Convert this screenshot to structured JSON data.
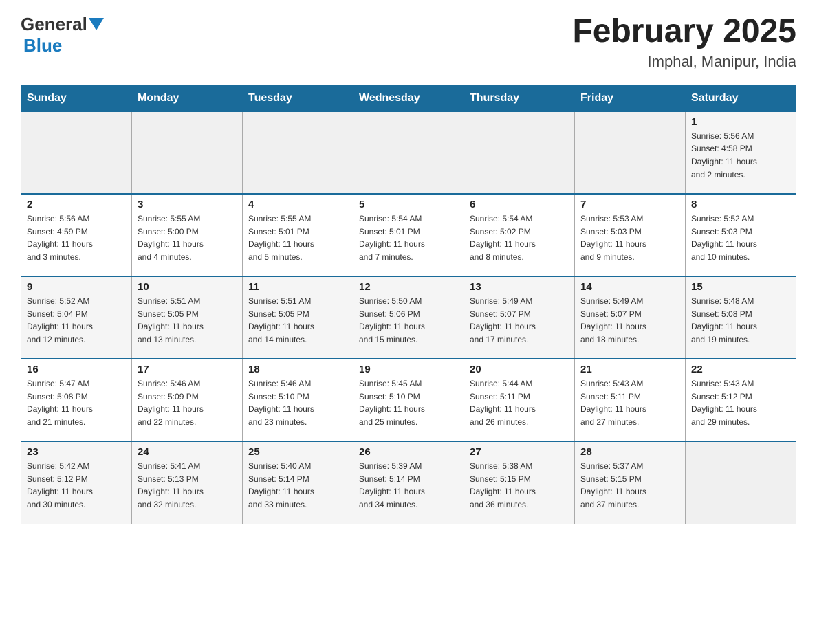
{
  "header": {
    "logo_general": "General",
    "logo_blue": "Blue",
    "month_title": "February 2025",
    "location": "Imphal, Manipur, India"
  },
  "days_of_week": [
    "Sunday",
    "Monday",
    "Tuesday",
    "Wednesday",
    "Thursday",
    "Friday",
    "Saturday"
  ],
  "weeks": [
    {
      "days": [
        {
          "num": "",
          "info": ""
        },
        {
          "num": "",
          "info": ""
        },
        {
          "num": "",
          "info": ""
        },
        {
          "num": "",
          "info": ""
        },
        {
          "num": "",
          "info": ""
        },
        {
          "num": "",
          "info": ""
        },
        {
          "num": "1",
          "info": "Sunrise: 5:56 AM\nSunset: 4:58 PM\nDaylight: 11 hours\nand 2 minutes."
        }
      ]
    },
    {
      "days": [
        {
          "num": "2",
          "info": "Sunrise: 5:56 AM\nSunset: 4:59 PM\nDaylight: 11 hours\nand 3 minutes."
        },
        {
          "num": "3",
          "info": "Sunrise: 5:55 AM\nSunset: 5:00 PM\nDaylight: 11 hours\nand 4 minutes."
        },
        {
          "num": "4",
          "info": "Sunrise: 5:55 AM\nSunset: 5:01 PM\nDaylight: 11 hours\nand 5 minutes."
        },
        {
          "num": "5",
          "info": "Sunrise: 5:54 AM\nSunset: 5:01 PM\nDaylight: 11 hours\nand 7 minutes."
        },
        {
          "num": "6",
          "info": "Sunrise: 5:54 AM\nSunset: 5:02 PM\nDaylight: 11 hours\nand 8 minutes."
        },
        {
          "num": "7",
          "info": "Sunrise: 5:53 AM\nSunset: 5:03 PM\nDaylight: 11 hours\nand 9 minutes."
        },
        {
          "num": "8",
          "info": "Sunrise: 5:52 AM\nSunset: 5:03 PM\nDaylight: 11 hours\nand 10 minutes."
        }
      ]
    },
    {
      "days": [
        {
          "num": "9",
          "info": "Sunrise: 5:52 AM\nSunset: 5:04 PM\nDaylight: 11 hours\nand 12 minutes."
        },
        {
          "num": "10",
          "info": "Sunrise: 5:51 AM\nSunset: 5:05 PM\nDaylight: 11 hours\nand 13 minutes."
        },
        {
          "num": "11",
          "info": "Sunrise: 5:51 AM\nSunset: 5:05 PM\nDaylight: 11 hours\nand 14 minutes."
        },
        {
          "num": "12",
          "info": "Sunrise: 5:50 AM\nSunset: 5:06 PM\nDaylight: 11 hours\nand 15 minutes."
        },
        {
          "num": "13",
          "info": "Sunrise: 5:49 AM\nSunset: 5:07 PM\nDaylight: 11 hours\nand 17 minutes."
        },
        {
          "num": "14",
          "info": "Sunrise: 5:49 AM\nSunset: 5:07 PM\nDaylight: 11 hours\nand 18 minutes."
        },
        {
          "num": "15",
          "info": "Sunrise: 5:48 AM\nSunset: 5:08 PM\nDaylight: 11 hours\nand 19 minutes."
        }
      ]
    },
    {
      "days": [
        {
          "num": "16",
          "info": "Sunrise: 5:47 AM\nSunset: 5:08 PM\nDaylight: 11 hours\nand 21 minutes."
        },
        {
          "num": "17",
          "info": "Sunrise: 5:46 AM\nSunset: 5:09 PM\nDaylight: 11 hours\nand 22 minutes."
        },
        {
          "num": "18",
          "info": "Sunrise: 5:46 AM\nSunset: 5:10 PM\nDaylight: 11 hours\nand 23 minutes."
        },
        {
          "num": "19",
          "info": "Sunrise: 5:45 AM\nSunset: 5:10 PM\nDaylight: 11 hours\nand 25 minutes."
        },
        {
          "num": "20",
          "info": "Sunrise: 5:44 AM\nSunset: 5:11 PM\nDaylight: 11 hours\nand 26 minutes."
        },
        {
          "num": "21",
          "info": "Sunrise: 5:43 AM\nSunset: 5:11 PM\nDaylight: 11 hours\nand 27 minutes."
        },
        {
          "num": "22",
          "info": "Sunrise: 5:43 AM\nSunset: 5:12 PM\nDaylight: 11 hours\nand 29 minutes."
        }
      ]
    },
    {
      "days": [
        {
          "num": "23",
          "info": "Sunrise: 5:42 AM\nSunset: 5:12 PM\nDaylight: 11 hours\nand 30 minutes."
        },
        {
          "num": "24",
          "info": "Sunrise: 5:41 AM\nSunset: 5:13 PM\nDaylight: 11 hours\nand 32 minutes."
        },
        {
          "num": "25",
          "info": "Sunrise: 5:40 AM\nSunset: 5:14 PM\nDaylight: 11 hours\nand 33 minutes."
        },
        {
          "num": "26",
          "info": "Sunrise: 5:39 AM\nSunset: 5:14 PM\nDaylight: 11 hours\nand 34 minutes."
        },
        {
          "num": "27",
          "info": "Sunrise: 5:38 AM\nSunset: 5:15 PM\nDaylight: 11 hours\nand 36 minutes."
        },
        {
          "num": "28",
          "info": "Sunrise: 5:37 AM\nSunset: 5:15 PM\nDaylight: 11 hours\nand 37 minutes."
        },
        {
          "num": "",
          "info": ""
        }
      ]
    }
  ]
}
